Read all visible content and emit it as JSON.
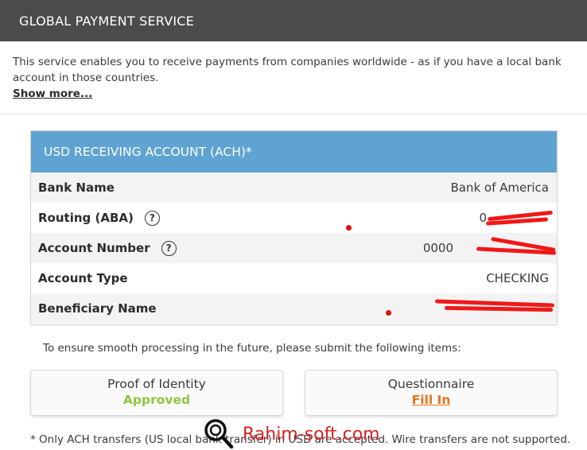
{
  "header": {
    "title": "GLOBAL PAYMENT SERVICE"
  },
  "intro": {
    "description": "This service enables you to receive payments from companies worldwide - as if you have a local bank account in those countries.",
    "show_more": "Show more..."
  },
  "account": {
    "title": "USD RECEIVING ACCOUNT (ACH)*",
    "rows": [
      {
        "label": "Bank Name",
        "value": "Bank of America"
      },
      {
        "label": "Routing (ABA)",
        "value": "0",
        "help": "?"
      },
      {
        "label": "Account Number",
        "value": "0000",
        "help": "?"
      },
      {
        "label": "Account Type",
        "value": "CHECKING"
      },
      {
        "label": "Beneficiary Name",
        "value": ""
      }
    ]
  },
  "notice": "To ensure smooth processing in the future, please submit the following items:",
  "documents": [
    {
      "title": "Proof of Identity",
      "status": "Approved"
    },
    {
      "title": "Questionnaire",
      "status": "Fill In"
    }
  ],
  "footnote": "* Only ACH transfers (US local bank transfer) in USD are accepted. Wire transfers are not supported.",
  "watermark": "Rahim-soft.com",
  "colors": {
    "header_bg": "#4b4b4b",
    "card_header_bg": "#5fa3d2",
    "approved": "#8cc63f",
    "fill_in": "#e8731e",
    "redaction": "#f01818"
  }
}
